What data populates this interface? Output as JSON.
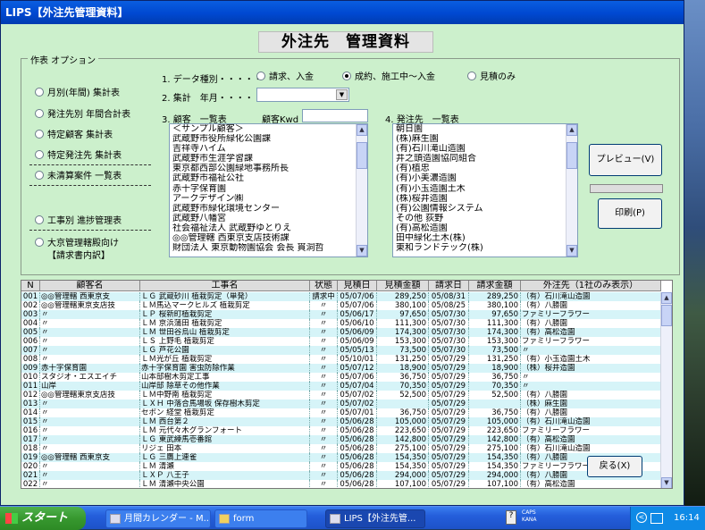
{
  "window": {
    "title": "LIPS【外注先管理資料】"
  },
  "page_title": "外注先　管理資料",
  "options": {
    "legend": "作表 オプション",
    "reports": [
      "月別(年間) 集計表",
      "発注先別 年間合計表",
      "特定顧客 集計表",
      "特定発注先 集計表",
      "未清算案件 一覧表",
      "工事別 進捗管理表",
      "大京管理轄殿向け"
    ],
    "report_sub": "【請求書内訳】"
  },
  "datatype": {
    "label": "1. データ種別・・・・・",
    "choices": [
      "請求、入金",
      "成約、施工中～入金",
      "見積のみ"
    ]
  },
  "aggregate": {
    "label": "2. 集計　年月・・・・・",
    "value": ""
  },
  "customers": {
    "label": "3. 顧客　一覧表",
    "kwd_label": "顧客Kwd",
    "kwd_value": "",
    "items": [
      "＜サンプル顧客＞",
      "武蔵野市役所緑化公園課",
      "吉祥寺ハイム",
      "武蔵野市生涯学習課",
      "東京都西部公園緑地事務所長",
      "武蔵野市福祉公社",
      "赤十字保育園",
      "アークデザイン㈱",
      "武蔵野市緑化環境センター",
      "武蔵野八幡宮",
      "社会福祉法人 武蔵野ゆとりえ",
      "◎◎管理轄 西東京支店技術課",
      "財団法人 東京動物園協会 会長 貫洞哲"
    ]
  },
  "suppliers": {
    "label": "4. 発注先　一覧表",
    "items": [
      "朝日園",
      "(株)麻生園",
      "(有)石川滝山造園",
      "井之頭造園協同組合",
      "(有)植忠",
      "(有)小美濃造園",
      "(有)小玉造園土木",
      "(株)桜井造園",
      "(有)公園情報システム",
      "その他 荻野",
      "(有)高松造園",
      "田中緑化土木(株)",
      "東和ランドテック(株)"
    ]
  },
  "buttons": {
    "preview": "プレビュー(V)",
    "print": "印刷(P)",
    "back": "戻る(X)"
  },
  "table": {
    "headers": [
      "N",
      "顧客名",
      "工事名",
      "状態",
      "見積日",
      "見積金額",
      "請求日",
      "請求金額",
      "外注先（1社のみ表示）"
    ],
    "rows": [
      [
        "001",
        "◎◎管理轄 西東京支",
        "ＬＧ 武蔵砂川 植栽剪定（単発）",
        "請求中",
        "05/07/06",
        "289,250",
        "05/08/31",
        "289,250",
        "（有）石川滝山造園"
      ],
      [
        "002",
        "◎◎管理轄東京支店技",
        "ＬＭ馬込マークヒルズ 植栽剪定",
        "〃",
        "05/07/06",
        "380,100",
        "05/08/25",
        "380,100",
        "（有）八勝園"
      ],
      [
        "003",
        "〃",
        "ＬＰ 桜新町植栽剪定",
        "〃",
        "05/06/17",
        "97,650",
        "05/07/30",
        "97,650",
        "ファミリーフラワー"
      ],
      [
        "004",
        "〃",
        "ＬＭ 京浜蒲田 植栽剪定",
        "〃",
        "05/06/10",
        "111,300",
        "05/07/30",
        "111,300",
        "（有）八勝園"
      ],
      [
        "005",
        "〃",
        "ＬＭ 世田谷烏山 植栽剪定",
        "〃",
        "05/06/09",
        "174,300",
        "05/07/30",
        "174,300",
        "（有）高松造園"
      ],
      [
        "006",
        "〃",
        "ＬＳ 上野毛 植栽剪定",
        "〃",
        "05/06/09",
        "153,300",
        "05/07/30",
        "153,300",
        "ファミリーフラワー"
      ],
      [
        "007",
        "〃",
        "ＬＧ 芦花公園",
        "〃",
        "05/05/13",
        "73,500",
        "05/07/30",
        "73,500",
        "〃"
      ],
      [
        "008",
        "〃",
        "ＬＭ光が丘 植栽剪定",
        "〃",
        "05/10/01",
        "131,250",
        "05/07/29",
        "131,250",
        "（有）小玉造園土木"
      ],
      [
        "009",
        "赤十字保育園",
        "赤十字保育園 害虫防除作業",
        "〃",
        "05/07/12",
        "18,900",
        "05/07/29",
        "18,900",
        "（株）桜井造園"
      ],
      [
        "010",
        "スタジオ・エスエイチ",
        "山本邸樹木剪定工事",
        "〃",
        "05/07/06",
        "36,750",
        "05/07/29",
        "36,750",
        "〃"
      ],
      [
        "011",
        "山岸",
        "山岸邸 除草その他作業",
        "〃",
        "05/07/04",
        "70,350",
        "05/07/29",
        "70,350",
        "〃"
      ],
      [
        "012",
        "◎◎管理轄東京支店技",
        "ＬＭ中野南 植栽剪定",
        "〃",
        "05/07/02",
        "52,500",
        "05/07/29",
        "52,500",
        "（有）八勝園"
      ],
      [
        "013",
        "〃",
        "ＬＸＨ 中落合馬場坂 保存樹木剪定",
        "〃",
        "05/07/02",
        "",
        "05/07/29",
        "",
        "（株）麻生園"
      ],
      [
        "014",
        "〃",
        "セボン 経堂 植栽剪定",
        "〃",
        "05/07/01",
        "36,750",
        "05/07/29",
        "36,750",
        "（有）八勝園"
      ],
      [
        "015",
        "〃",
        "ＬＭ 西台第２",
        "〃",
        "05/06/28",
        "105,000",
        "05/07/29",
        "105,000",
        "（有）石川滝山造園"
      ],
      [
        "016",
        "〃",
        "ＬＭ 元代々木グランフォート",
        "〃",
        "05/06/28",
        "223,650",
        "05/07/29",
        "223,650",
        "ファミリーフラワー"
      ],
      [
        "017",
        "〃",
        "ＬＧ 東武練馬壱番館",
        "〃",
        "05/06/28",
        "142,800",
        "05/07/29",
        "142,800",
        "（有）高松造園"
      ],
      [
        "018",
        "〃",
        "リジェ 田本",
        "〃",
        "05/06/28",
        "275,100",
        "05/07/29",
        "275,100",
        "（有）石川滝山造園"
      ],
      [
        "019",
        "◎◎管理轄 西東京支",
        "ＬＧ 三鷹上連雀",
        "〃",
        "05/06/28",
        "154,350",
        "05/07/29",
        "154,350",
        "（有）八勝園"
      ],
      [
        "020",
        "〃",
        "ＬＭ 清瀬",
        "〃",
        "05/06/28",
        "154,350",
        "05/07/29",
        "154,350",
        "ファミリーフラワー"
      ],
      [
        "021",
        "〃",
        "ＬＸＰ 八王子",
        "〃",
        "05/06/28",
        "294,000",
        "05/07/29",
        "294,000",
        "（有）八勝園"
      ],
      [
        "022",
        "〃",
        "ＬＭ 清瀬中央公園",
        "〃",
        "05/06/28",
        "107,100",
        "05/07/29",
        "107,100",
        "（有）高松造園"
      ]
    ]
  },
  "taskbar": {
    "start": "スタート",
    "items": [
      "月間カレンダー - M...",
      "form",
      "LIPS【外注先管..."
    ],
    "tray_caps": "CAPS",
    "tray_kana": "KANA",
    "clock": "16:14"
  }
}
